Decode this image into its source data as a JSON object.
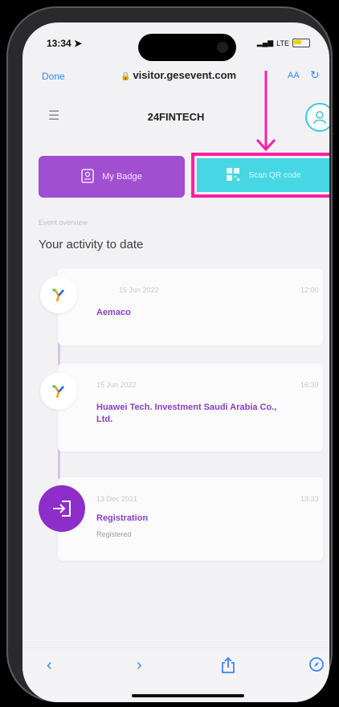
{
  "status_bar": {
    "time": "13:34 ➤",
    "network": "LTE"
  },
  "browser": {
    "done_label": "Done",
    "url": "visitor.gesevent.com",
    "text_size": "AA"
  },
  "app": {
    "title": "24FINTECH"
  },
  "buttons": {
    "my_badge": "My Badge",
    "scan_qr": "Scan QR code"
  },
  "activity": {
    "section_label": "Event overview",
    "title": "Your activity to date",
    "items": [
      {
        "date": "15 Jun 2022",
        "time": "12:00",
        "name": "Aemaco",
        "sub": ""
      },
      {
        "date": "15 Jun 2022",
        "time": "16:30",
        "name": "Huawei Tech. Investment Saudi Arabia Co., Ltd.",
        "sub": ""
      },
      {
        "date": "13 Dec 2021",
        "time": "13:33",
        "name": "Registration",
        "sub": "Registered"
      }
    ]
  },
  "colors": {
    "accent_purple": "#a14fd1",
    "accent_cyan": "#47d7e4",
    "highlight_pink": "#ff1ea5",
    "link_blue": "#3a86ff"
  }
}
